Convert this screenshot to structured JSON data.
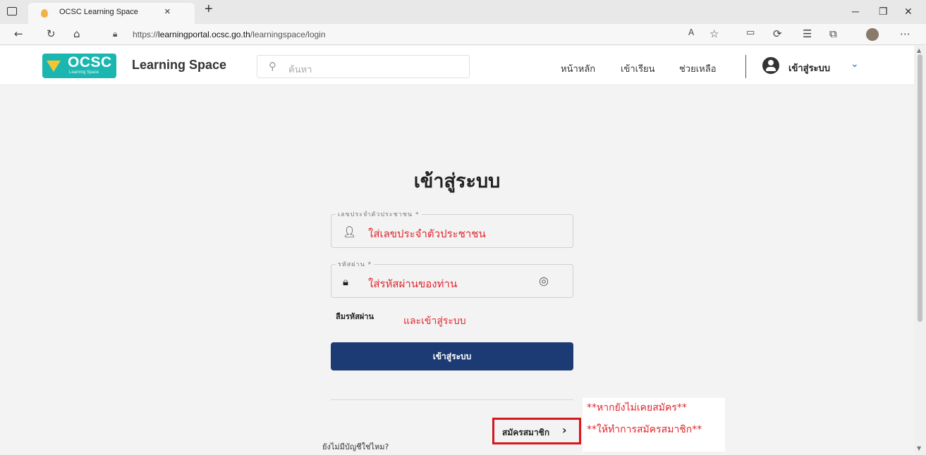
{
  "browser": {
    "tab_title": "OCSC Learning Space",
    "tab_close": "×",
    "new_tab": "+",
    "url_prefix": "https://",
    "url_host": "learningportal.ocsc.go.th",
    "url_path": "/learningspace/login"
  },
  "header": {
    "logo_text": "OCSC",
    "logo_sub": "Learning Space",
    "brand": "Learning Space",
    "search_placeholder": "ค้นหา",
    "nav": [
      "หน้าหลัก",
      "เข้าเรียน",
      "ช่วยเหลือ"
    ],
    "login_label": "เข้าสู่ระบบ"
  },
  "form": {
    "title": "เข้าสู่ระบบ",
    "id_label": "เลขประจำตัวประชาชน *",
    "id_value": "ใส่เลขประจำตัวประชาชน",
    "password_label": "รหัสผ่าน *",
    "password_value": "ใส่รหัสผ่านของท่าน",
    "forgot_password": "ลืมรหัสผ่าน",
    "submit_label": "เข้าสู่ระบบ",
    "no_account": "ยังไม่มีบัญชีใช่ไหม?",
    "signup_label": "สมัครสมาชิก"
  },
  "annotations": {
    "login_note": "และเข้าสู่ระบบ",
    "signup_note_1": "**หากยังไม่เคยสมัคร**",
    "signup_note_2": "**ให้ทำการสมัครสมาชิก**",
    "color": "#e0262e",
    "highlight_color": "#d8161c"
  },
  "colors": {
    "logo_bg": "#1cb6b0",
    "submit_bg": "#1c3a73",
    "accent": "#2a6bd1"
  }
}
